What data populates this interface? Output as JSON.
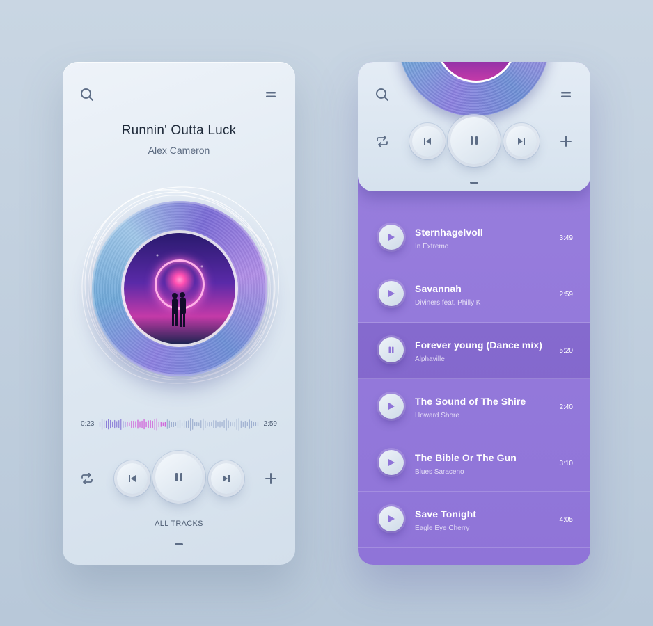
{
  "player": {
    "song_title": "Runnin' Outta Luck",
    "artist": "Alex Cameron",
    "time_elapsed": "0:23",
    "time_total": "2:59",
    "progress": 0.13,
    "all_tracks_label": "ALL TRACKS"
  },
  "icons": {
    "search": "search-icon",
    "menu": "menu-icon",
    "repeat": "repeat-icon",
    "previous": "previous-icon",
    "pause": "pause-icon",
    "next": "next-icon",
    "add": "plus-icon",
    "play": "play-icon"
  },
  "colors": {
    "accent_purple": "#8f74d8",
    "wave_played": "#d05bd8",
    "wave_unplayed": "#9fb0d0",
    "icon": "#5d6d86"
  },
  "tracks": [
    {
      "title": "Sternhagelvoll",
      "artist": "In Extremo",
      "duration": "3:49",
      "state": "play"
    },
    {
      "title": "Savannah",
      "artist": "Diviners feat. Philly K",
      "duration": "2:59",
      "state": "play"
    },
    {
      "title": "Forever young (Dance mix)",
      "artist": "Alphaville",
      "duration": "5:20",
      "state": "pause"
    },
    {
      "title": "The Sound of The Shire",
      "artist": "Howard Shore",
      "duration": "2:40",
      "state": "play"
    },
    {
      "title": "The Bible Or The Gun",
      "artist": "Blues Saraceno",
      "duration": "3:10",
      "state": "play"
    },
    {
      "title": "Save Tonight",
      "artist": "Eagle Eye Cherry",
      "duration": "4:05",
      "state": "play"
    }
  ]
}
